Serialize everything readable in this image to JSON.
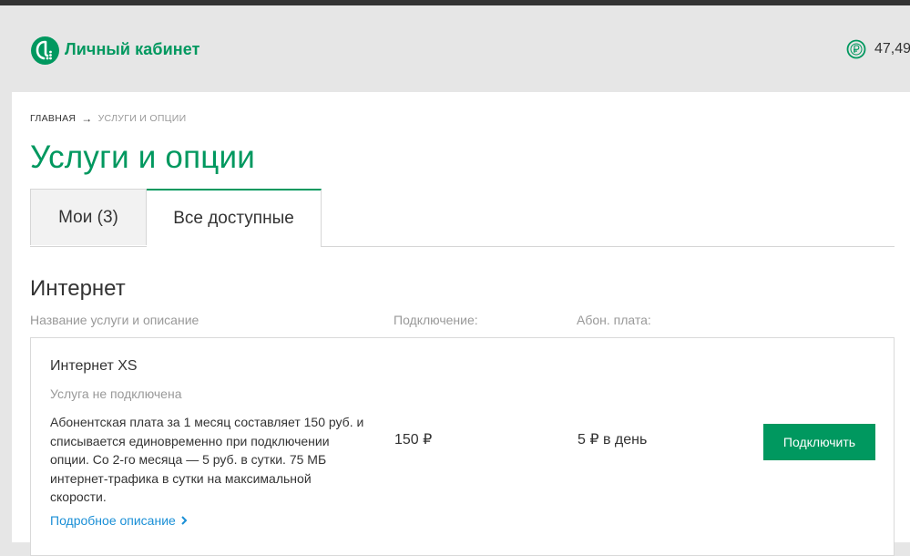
{
  "header": {
    "brand": "Личный кабинет",
    "balance": "47,49",
    "logo_icon": "megafon-logo-icon",
    "balance_icon": "ruble-coin-icon",
    "accent_color": "#00985f"
  },
  "breadcrumb": {
    "home": "ГЛАВНАЯ",
    "separator": "→",
    "current": "УСЛУГИ И ОПЦИИ"
  },
  "page": {
    "title": "Услуги и опции"
  },
  "tabs": [
    {
      "label": "Мои (3)",
      "active": false
    },
    {
      "label": "Все доступные",
      "active": true
    }
  ],
  "section": {
    "title": "Интернет",
    "columns": {
      "name": "Название услуги и описание",
      "connection": "Подключение:",
      "fee": "Абон. плата:"
    }
  },
  "service": {
    "name": "Интернет XS",
    "status": "Услуга не подключена",
    "description": "Абонентская плата за 1 месяц составляет 150 руб. и списывается единовременно при подключении опции. Со 2-го месяца — 5 руб. в сутки. 75 МБ интернет-трафика в сутки на максимальной скорости.",
    "more_link": "Подробное описание",
    "price": "150 ₽",
    "fee": "5 ₽ в день",
    "button": "Подключить",
    "link_color": "#1a8fd6"
  }
}
